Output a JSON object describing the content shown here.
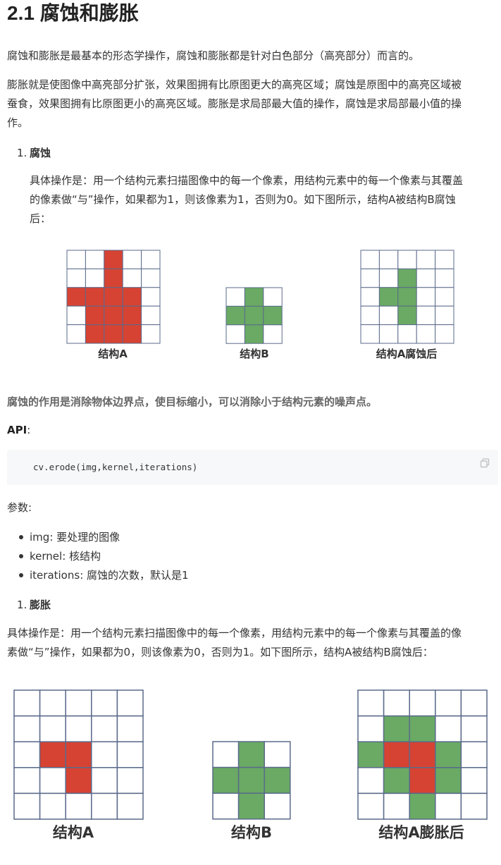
{
  "title": "2.1 腐蚀和膨胀",
  "intro_p1": "腐蚀和膨胀是最基本的形态学操作，腐蚀和膨胀都是针对白色部分（高亮部分）而言的。",
  "intro_p2_l1": "膨胀就是使图像中高亮部分扩张，效果图拥有比原图更大的高亮区域；腐蚀是原图中的高亮区域被",
  "intro_p2_l2": "蚕食，效果图拥有比原图更小的高亮区域。膨胀是求局部最大值的操作，腐蚀是求局部最小值的操",
  "intro_p2_l3": "作。",
  "erode": {
    "number": "1.",
    "heading": "腐蚀",
    "desc_l1": "具体操作是：用一个结构元素扫描图像中的每一个像素，用结构元素中的每一个像素与其覆盖",
    "desc_l2": "的像素做“与”操作，如果都为1，则该像素为1，否则为0。如下图所示，结构A被结构B腐蚀",
    "desc_l3": "后：",
    "captions": [
      "结构A",
      "结构B",
      "结构A腐蚀后"
    ],
    "effect": "腐蚀的作用是消除物体边界点，使目标缩小，可以消除小于结构元素的噪声点。",
    "api_label": "API",
    "api_colon": ":",
    "code": "cv.erode(img,kernel,iterations)",
    "params_label": "参数:",
    "params": [
      {
        "name": "img",
        "desc": ": 要处理的图像"
      },
      {
        "name": "kernel",
        "desc": ": 核结构"
      },
      {
        "name": "iterations",
        "desc": ": 腐蚀的次数，默认是1"
      }
    ]
  },
  "dilate": {
    "number": "1.",
    "heading": "膨胀",
    "desc_l1": "具体操作是：用一个结构元素扫描图像中的每一个像素，用结构元素中的每一个像素与其覆盖的像",
    "desc_l2": "素做“与”操作，如果都为0，则该像素为0，否则为1。如下图所示，结构A被结构B腐蚀后：",
    "captions": [
      "结构A",
      "结构B",
      "结构A膨胀后"
    ]
  },
  "colors": {
    "red": "#d64333",
    "green": "#6aaa64",
    "grid": "#5a6a8a"
  },
  "grids": {
    "erodeA": [
      "00100",
      "00100",
      "11110",
      "01110",
      "01110"
    ],
    "erodeB": [
      "010",
      "111",
      "010"
    ],
    "erodeResult": [
      "00000",
      "00000",
      "00100",
      "00100",
      "00000"
    ],
    "erodeResultFill": [
      "00000",
      "00100",
      "01100",
      "00100",
      "00000"
    ],
    "dilateA": [
      "00000",
      "00000",
      "01100",
      "00100",
      "00000"
    ],
    "dilateB": [
      "010",
      "111",
      "010"
    ],
    "dilateResult": [
      "00000",
      "01100",
      "12210",
      "01210",
      "00100"
    ]
  }
}
